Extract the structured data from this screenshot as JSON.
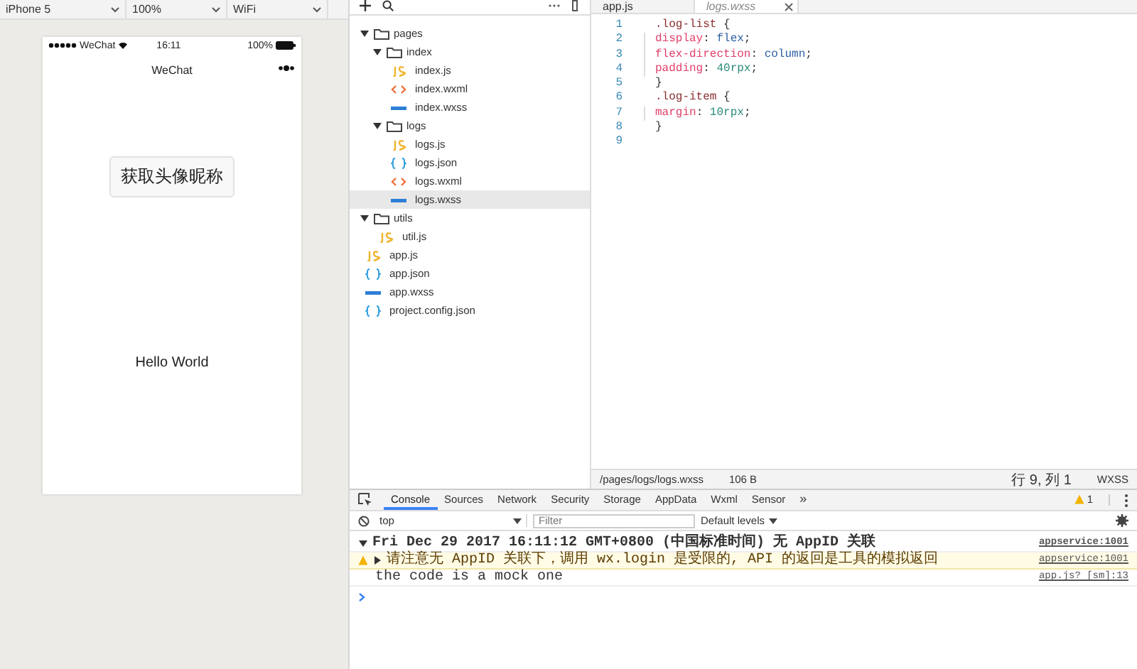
{
  "simulator_toolbar": {
    "device": "iPhone 5",
    "zoom": "100%",
    "network": "WiFi"
  },
  "phone": {
    "carrier": "WeChat",
    "time": "16:11",
    "battery": "100%",
    "nav_title": "WeChat",
    "button": "获取头像昵称",
    "text": "Hello World"
  },
  "file_tree": [
    {
      "kind": "folder",
      "name": "pages",
      "expanded": true,
      "children": [
        {
          "kind": "folder",
          "name": "index",
          "expanded": true,
          "children": [
            {
              "kind": "js",
              "name": "index.js",
              "selected": false
            },
            {
              "kind": "wxml",
              "name": "index.wxml",
              "selected": false
            },
            {
              "kind": "wxss",
              "name": "index.wxss",
              "selected": false
            }
          ]
        },
        {
          "kind": "folder",
          "name": "logs",
          "expanded": true,
          "children": [
            {
              "kind": "js",
              "name": "logs.js",
              "selected": false
            },
            {
              "kind": "json",
              "name": "logs.json",
              "selected": false
            },
            {
              "kind": "wxml",
              "name": "logs.wxml",
              "selected": false
            },
            {
              "kind": "wxss",
              "name": "logs.wxss",
              "selected": true
            }
          ]
        }
      ]
    },
    {
      "kind": "folder",
      "name": "utils",
      "expanded": true,
      "children": [
        {
          "kind": "js",
          "name": "util.js",
          "selected": false
        }
      ]
    },
    {
      "kind": "js",
      "name": "app.js",
      "selected": false
    },
    {
      "kind": "json",
      "name": "app.json",
      "selected": false
    },
    {
      "kind": "wxss",
      "name": "app.wxss",
      "selected": false
    },
    {
      "kind": "json",
      "name": "project.config.json",
      "selected": false
    }
  ],
  "editor": {
    "tabs": [
      {
        "label": "app.js",
        "selected": false
      },
      {
        "label": "logs.wxss",
        "selected": true
      }
    ],
    "lines": [
      {
        "number": "1",
        "indent": false,
        "tokens": [
          {
            "kind": "selector",
            "text": ".log-list"
          },
          {
            "kind": "punct",
            "text": " {"
          }
        ]
      },
      {
        "number": "2",
        "indent": true,
        "tokens": [
          {
            "kind": "property",
            "text": "display"
          },
          {
            "kind": "punct",
            "text": ": "
          },
          {
            "kind": "value",
            "text": "flex"
          },
          {
            "kind": "punct",
            "text": ";"
          }
        ]
      },
      {
        "number": "3",
        "indent": true,
        "tokens": [
          {
            "kind": "property",
            "text": "flex-direction"
          },
          {
            "kind": "punct",
            "text": ": "
          },
          {
            "kind": "value",
            "text": "column"
          },
          {
            "kind": "punct",
            "text": ";"
          }
        ]
      },
      {
        "number": "4",
        "indent": true,
        "tokens": [
          {
            "kind": "property",
            "text": "padding"
          },
          {
            "kind": "punct",
            "text": ": "
          },
          {
            "kind": "number",
            "text": "40rpx"
          },
          {
            "kind": "punct",
            "text": ";"
          }
        ]
      },
      {
        "number": "5",
        "indent": false,
        "tokens": [
          {
            "kind": "punct",
            "text": "}"
          }
        ]
      },
      {
        "number": "6",
        "indent": false,
        "tokens": [
          {
            "kind": "selector",
            "text": ".log-item"
          },
          {
            "kind": "punct",
            "text": " {"
          }
        ]
      },
      {
        "number": "7",
        "indent": true,
        "tokens": [
          {
            "kind": "property",
            "text": "margin"
          },
          {
            "kind": "punct",
            "text": ": "
          },
          {
            "kind": "number",
            "text": "10rpx"
          },
          {
            "kind": "punct",
            "text": ";"
          }
        ]
      },
      {
        "number": "8",
        "indent": false,
        "tokens": [
          {
            "kind": "punct",
            "text": "}"
          }
        ]
      },
      {
        "number": "9"
      }
    ],
    "status_bar": {
      "path": "/pages/logs/logs.wxss",
      "size": "106 B",
      "position": "行 9, 列 1",
      "language": "WXSS"
    }
  },
  "devtools": {
    "tabs": [
      {
        "label": "Console",
        "selected": true
      },
      {
        "label": "Sources",
        "selected": false
      },
      {
        "label": "Network",
        "selected": false
      },
      {
        "label": "Security",
        "selected": false
      },
      {
        "label": "Storage",
        "selected": false
      },
      {
        "label": "AppData",
        "selected": false
      },
      {
        "label": "Wxml",
        "selected": false
      },
      {
        "label": "Sensor",
        "selected": false
      }
    ],
    "more": "»",
    "warning_count": "1",
    "context": "top",
    "filter_placeholder": "Filter",
    "levels": "Default levels",
    "messages": [
      {
        "kind": "group",
        "expanded": true,
        "text": "Fri Dec 29 2017 16:11:12 GMT+0800 (中国标准时间) 无 AppID 关联",
        "source": "appservice:1001"
      },
      {
        "kind": "warning",
        "expanded": false,
        "text": "请注意无 AppID 关联下，调用 wx.login 是受限的, API 的返回是工具的模拟返回",
        "source": "appservice:1001"
      },
      {
        "kind": "log",
        "text": "the code is a mock one",
        "source": "app.js? [sm]:13"
      }
    ]
  }
}
